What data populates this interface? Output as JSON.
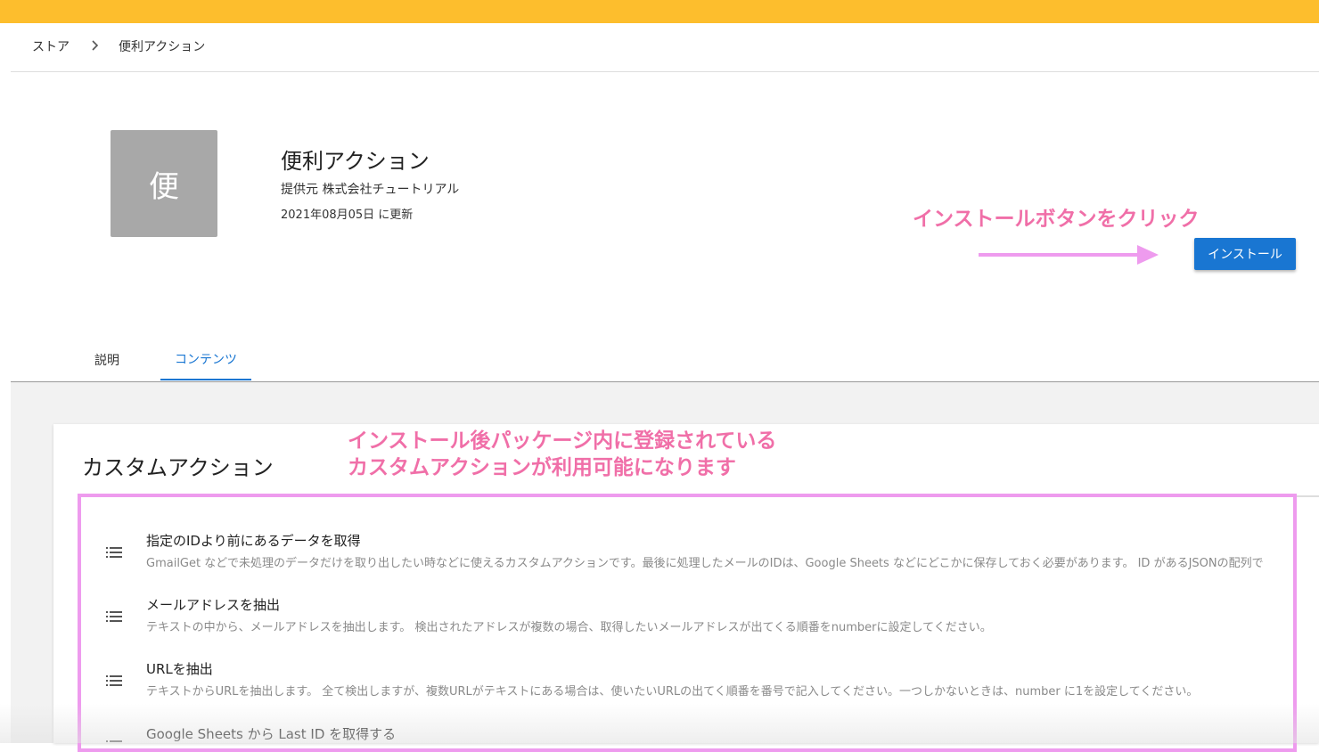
{
  "breadcrumb": {
    "items": [
      "ストア",
      "便利アクション"
    ]
  },
  "app": {
    "icon_char": "便",
    "title": "便利アクション",
    "provider": "提供元 株式会社チュートリアル",
    "updated": "2021年08月05日 に更新",
    "install_label": "インストール"
  },
  "annotations": {
    "install_hint": "インストールボタンをクリック",
    "custom_line1": "インストール後パッケージ内に登録されている",
    "custom_line2": "カスタムアクションが利用可能になります"
  },
  "tabs": [
    {
      "label": "説明",
      "active": false
    },
    {
      "label": "コンテンツ",
      "active": true
    }
  ],
  "section": {
    "title": "カスタムアクション"
  },
  "actions": [
    {
      "title": "指定のIDより前にあるデータを取得",
      "description": "GmailGet などで未処理のデータだけを取り出したい時などに使えるカスタムアクションです。最後に処理したメールのIDは、Google Sheets などにどこかに保存しておく必要があります。 ID があるJSONの配列で"
    },
    {
      "title": "メールアドレスを抽出",
      "description": "テキストの中から、メールアドレスを抽出します。 検出されたアドレスが複数の場合、取得したいメールアドレスが出てくる順番をnumberに設定してください。"
    },
    {
      "title": "URLを抽出",
      "description": "テキストからURLを抽出します。 全て検出しますが、複数URLがテキストにある場合は、使いたいURLの出てく順番を番号で記入してください。一つしかないときは、number に1を設定してください。"
    },
    {
      "title": "Google Sheets から Last ID を取得する",
      "description": ""
    }
  ],
  "colors": {
    "topbar": "#FDBE2D",
    "primary": "#1976D2",
    "annotation_text": "#F06FA8",
    "annotation_box": "#EE9BEE"
  }
}
